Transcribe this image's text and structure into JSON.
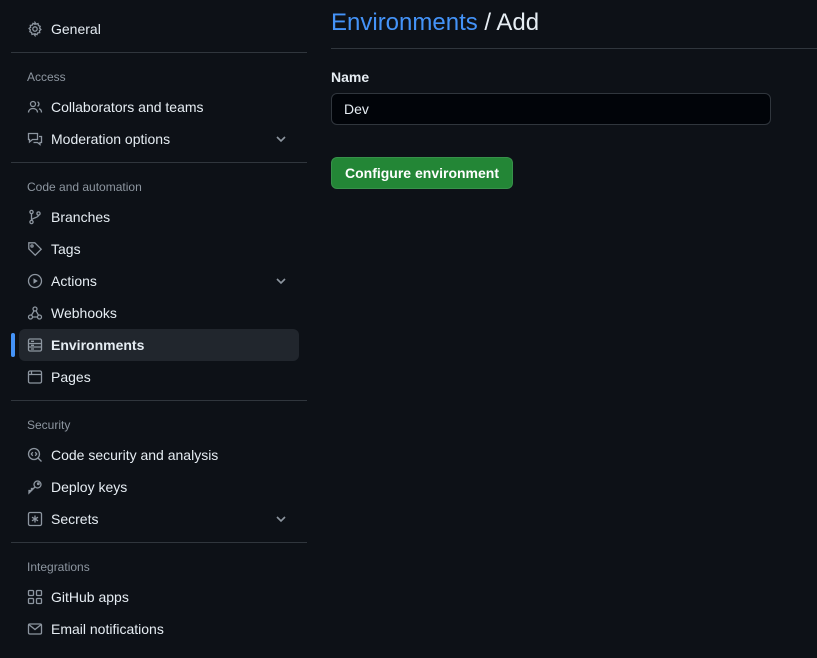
{
  "sidebar": {
    "general": {
      "label": "General",
      "icon": "gear-icon"
    },
    "sections": {
      "access": "Access",
      "code_automation": "Code and automation",
      "security": "Security",
      "integrations": "Integrations"
    },
    "items": {
      "collaborators": {
        "label": "Collaborators and teams",
        "icon": "people-icon"
      },
      "moderation": {
        "label": "Moderation options",
        "icon": "comment-discussion-icon",
        "expandable": true
      },
      "branches": {
        "label": "Branches",
        "icon": "git-branch-icon"
      },
      "tags": {
        "label": "Tags",
        "icon": "tag-icon"
      },
      "actions": {
        "label": "Actions",
        "icon": "play-icon",
        "expandable": true
      },
      "webhooks": {
        "label": "Webhooks",
        "icon": "webhook-icon"
      },
      "environments": {
        "label": "Environments",
        "icon": "server-icon",
        "active": true
      },
      "pages": {
        "label": "Pages",
        "icon": "browser-icon"
      },
      "code_security": {
        "label": "Code security and analysis",
        "icon": "codescan-icon"
      },
      "deploy_keys": {
        "label": "Deploy keys",
        "icon": "key-icon"
      },
      "secrets": {
        "label": "Secrets",
        "icon": "asterisk-icon",
        "expandable": true
      },
      "github_apps": {
        "label": "GitHub apps",
        "icon": "apps-icon"
      },
      "email_notifications": {
        "label": "Email notifications",
        "icon": "mail-icon"
      }
    }
  },
  "main": {
    "breadcrumb_link": "Environments",
    "breadcrumb_sep": " / ",
    "breadcrumb_current": "Add",
    "name_label": "Name",
    "name_value": "Dev",
    "submit_label": "Configure environment"
  },
  "colors": {
    "background": "#0d1117",
    "accent": "#4493f8",
    "primary_button": "#238636",
    "text_muted": "#8d96a0"
  }
}
